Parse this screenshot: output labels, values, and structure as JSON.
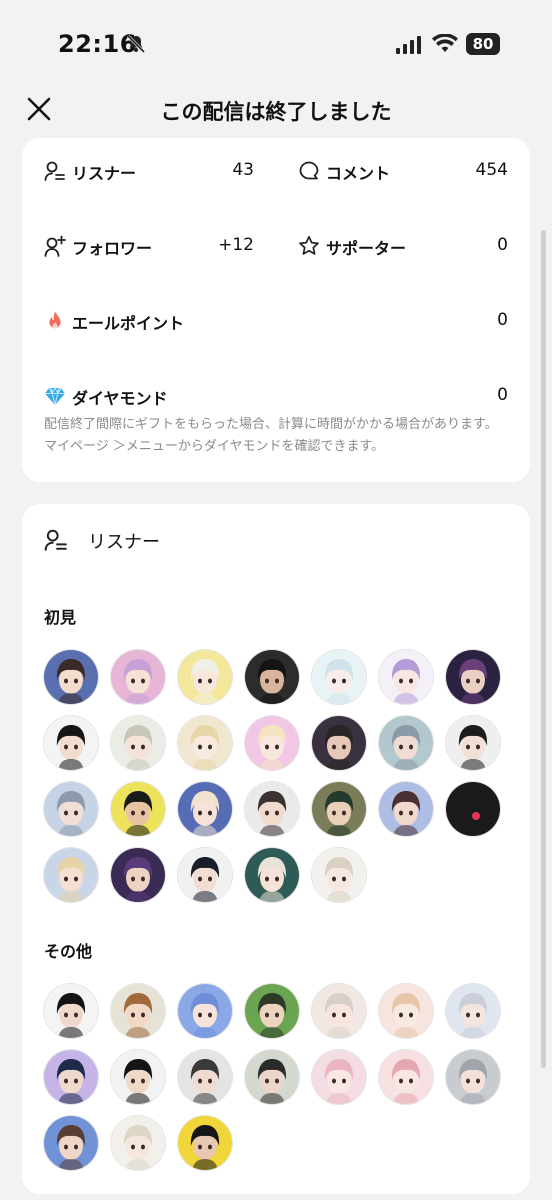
{
  "status_bar": {
    "time": "22:16",
    "battery": "80"
  },
  "nav": {
    "title": "この配信は終了しました"
  },
  "stats": {
    "listeners": {
      "label": "リスナー",
      "value": "43"
    },
    "comments": {
      "label": "コメント",
      "value": "454"
    },
    "followers": {
      "label": "フォロワー",
      "value": "+12"
    },
    "supporters": {
      "label": "サポーター",
      "value": "0"
    },
    "yell_points": {
      "label": "エールポイント",
      "value": "0"
    },
    "diamonds": {
      "label": "ダイヤモンド",
      "value": "0"
    },
    "note": "配信終了間際にギフトをもらった場合、計算に時間がかかる場合があります。マイページ ＞メニューからダイヤモンドを確認できます。"
  },
  "listener_list": {
    "header": "リスナー",
    "sections": [
      {
        "title": "初見",
        "avatars": [
          {
            "bg": "#5a6fb0",
            "hair": "#3a2a2a",
            "skin": "#f3dccb"
          },
          {
            "bg": "#e7b6d6",
            "hair": "#c7a0d8",
            "skin": "#f6e1d6"
          },
          {
            "bg": "#f3e79b",
            "hair": "#f0f0e8",
            "skin": "#f8e8dc"
          },
          {
            "bg": "#2c2c2c",
            "hair": "#141414",
            "skin": "#d8b49c"
          },
          {
            "bg": "#e8f3f6",
            "hair": "#cfe3ea",
            "skin": "#f7eeea"
          },
          {
            "bg": "#f4f0f8",
            "hair": "#b49cd8",
            "skin": "#f7e6e2"
          },
          {
            "bg": "#2b2140",
            "hair": "#6a3f7a",
            "skin": "#e8cfc2"
          },
          {
            "bg": "#f4f4f4",
            "hair": "#151515",
            "skin": "#f2dccf"
          },
          {
            "bg": "#ecece6",
            "hair": "#c9c6ba",
            "skin": "#f5e3d8"
          },
          {
            "bg": "#f1e6d0",
            "hair": "#e9d6a8",
            "skin": "#f8eadf"
          },
          {
            "bg": "#f2c7e6",
            "hair": "#f5e4c0",
            "skin": "#f8e7dc"
          },
          {
            "bg": "#3a3140",
            "hair": "#2a2424",
            "skin": "#e6c8b8"
          },
          {
            "bg": "#b3c7cf",
            "hair": "#8a9aa6",
            "skin": "#efdcd2"
          },
          {
            "bg": "#efefef",
            "hair": "#1c1c1c",
            "skin": "#f2dfd6"
          },
          {
            "bg": "#c6d3e4",
            "hair": "#8d99ad",
            "skin": "#f0dfd7"
          },
          {
            "bg": "#ece35a",
            "hair": "#1a1a1a",
            "skin": "#e9c4a4"
          },
          {
            "bg": "#566db6",
            "hair": "#f0e2cc",
            "skin": "#f6e3d6"
          },
          {
            "bg": "#eaeaea",
            "hair": "#3b3232",
            "skin": "#f1dbcd"
          },
          {
            "bg": "#7a7d58",
            "hair": "#233b2c",
            "skin": "#ead0bb"
          },
          {
            "bg": "#aebde4",
            "hair": "#4a3033",
            "skin": "#efd8cc"
          },
          {
            "bg": "#1a1a1a",
            "hair": "#1a1a1a",
            "skin": "#1a1a1a"
          },
          {
            "bg": "#c9d6e8",
            "hair": "#e7d3a8",
            "skin": "#f4dfd2"
          },
          {
            "bg": "#3a2b55",
            "hair": "#5a3a7a",
            "skin": "#ecd3c4"
          },
          {
            "bg": "#f1f1f1",
            "hair": "#181d2a",
            "skin": "#f2ddd2"
          },
          {
            "bg": "#2f5b57",
            "hair": "#e9e2d6",
            "skin": "#f5e3d8"
          },
          {
            "bg": "#f3f1ee",
            "hair": "#d9d2c3",
            "skin": "#f6e8e0"
          }
        ]
      },
      {
        "title": "その他",
        "avatars": [
          {
            "bg": "#f4f4f4",
            "hair": "#141414",
            "skin": "#f0d8cc"
          },
          {
            "bg": "#e7e2d6",
            "hair": "#a06a3a",
            "skin": "#f2d9c6"
          },
          {
            "bg": "#8aa8e6",
            "hair": "#6e8fd8",
            "skin": "#f6e4da"
          },
          {
            "bg": "#6ba552",
            "hair": "#2d3a28",
            "skin": "#eed3c0"
          },
          {
            "bg": "#f1e8e4",
            "hair": "#d9cfc9",
            "skin": "#f6e6de"
          },
          {
            "bg": "#f6e4df",
            "hair": "#e6c6a8",
            "skin": "#f8e9e1"
          },
          {
            "bg": "#dfe6f0",
            "hair": "#c9ced8",
            "skin": "#f3e4dd"
          },
          {
            "bg": "#c6b4e8",
            "hair": "#1e2a4a",
            "skin": "#efd8cc"
          },
          {
            "bg": "#f2f2f2",
            "hair": "#151515",
            "skin": "#f0d8c8"
          },
          {
            "bg": "#e4e4e4",
            "hair": "#3a3a3a",
            "skin": "#efdbd0"
          },
          {
            "bg": "#d4d9d0",
            "hair": "#2c2b2b",
            "skin": "#ecd6c9"
          },
          {
            "bg": "#f3dde2",
            "hair": "#eab5c0",
            "skin": "#f8e7e2"
          },
          {
            "bg": "#f6e0e2",
            "hair": "#e7a7b2",
            "skin": "#f8e6e0"
          },
          {
            "bg": "#c8ccd0",
            "hair": "#9fa5ab",
            "skin": "#f1e1d9"
          },
          {
            "bg": "#6f93d6",
            "hair": "#5a3e34",
            "skin": "#f0d6c6"
          },
          {
            "bg": "#f2f0ea",
            "hair": "#ddd6c6",
            "skin": "#f6e7de"
          },
          {
            "bg": "#f1d63a",
            "hair": "#161616",
            "skin": "#e8c8b2"
          }
        ]
      }
    ]
  }
}
